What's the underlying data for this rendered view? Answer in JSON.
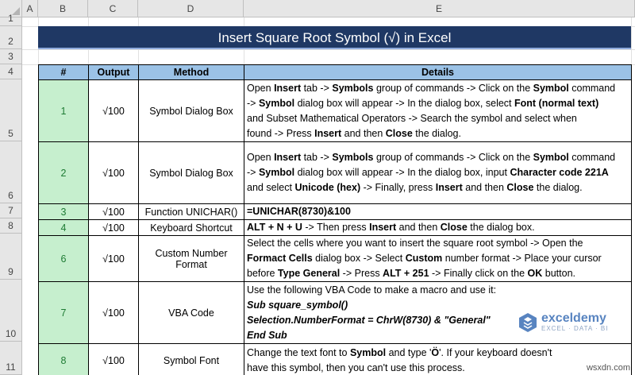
{
  "columns": [
    "A",
    "B",
    "C",
    "D",
    "E"
  ],
  "rows": [
    "1",
    "2",
    "3",
    "4",
    "5",
    "6",
    "7",
    "8",
    "9",
    "10",
    "11"
  ],
  "title": "Insert Square Root Symbol (√) in Excel",
  "headers": {
    "num": "#",
    "output": "Output",
    "method": "Method",
    "details": "Details"
  },
  "entries": [
    {
      "num": "1",
      "output": "√100",
      "method": "Symbol Dialog Box"
    },
    {
      "num": "2",
      "output": "√100",
      "method": "Symbol Dialog Box"
    },
    {
      "num": "3",
      "output": "√100",
      "method": "Function UNICHAR()"
    },
    {
      "num": "4",
      "output": "√100",
      "method": "Keyboard Shortcut"
    },
    {
      "num": "6",
      "output": "√100",
      "method": "Custom Number Format"
    },
    {
      "num": "7",
      "output": "√100",
      "method": "VBA Code"
    },
    {
      "num": "8",
      "output": "√100",
      "method": "Symbol Font"
    }
  ],
  "details": {
    "d1": {
      "t1": "Open ",
      "b1": "Insert",
      "t2": " tab -> ",
      "b2": "Symbols",
      "t3": " group of commands -> Click on the ",
      "b3": "Symbol",
      "t4": " command",
      "t5": "-> ",
      "b4": "Symbol",
      "t6": " dialog box will appear -> In the dialog box, select ",
      "b5": "Font (normal text)",
      "t7": "and Subset Mathematical Operators -> Search the symbol and select when",
      "t8": "found -> Press ",
      "b6": "Insert",
      "t9": " and then ",
      "b7": "Close",
      "t10": " the dialog."
    },
    "d2": {
      "t1": "Open ",
      "b1": "Insert",
      "t2": " tab -> ",
      "b2": "Symbols",
      "t3": " group of commands -> Click on the ",
      "b3": "Symbol",
      "t4": " command",
      "t5": "-> ",
      "b4": "Symbol",
      "t6": " dialog box will appear -> In the dialog box, input ",
      "b5": "Character code 221A",
      "t7": "and select ",
      "b6": "Unicode (hex)",
      "t8": " -> Finally, press ",
      "b7": "Insert",
      "t9": " and then ",
      "b8": "Close",
      "t10": " the dialog."
    },
    "d3": {
      "b1": "=UNICHAR(8730)&100"
    },
    "d4": {
      "b1": "ALT + N + U",
      "t1": " -> Then press ",
      "b2": "Insert",
      "t2": " and then ",
      "b3": "Close",
      "t3": " the dialog box."
    },
    "d6": {
      "t1": "Select the cells where you want to insert the square root symbol -> Open the",
      "b1": "Formact Cells",
      "t2": " dialog box -> Select ",
      "b2": "Custom",
      "t3": " number format -> Place your cursor",
      "t4": "before ",
      "b3": "Type General",
      "t5": " -> Press ",
      "b4": "ALT + 251",
      "t6": " -> Finally click on the ",
      "b5": "OK",
      "t7": " button."
    },
    "d7": {
      "t1": "Use the following VBA Code to make a macro and use it:",
      "i1": "Sub square_symbol()",
      "i2": "Selection.NumberFormat = ChrW(8730) & \"General\"",
      "i3": "End Sub"
    },
    "d8": {
      "t1": "Change the text font to ",
      "b1": "Symbol",
      "t2": " and type '",
      "b2": "Ö",
      "t3": "'. If your keyboard doesn't",
      "t4": "have this symbol, then you can't use this process."
    }
  },
  "watermark": {
    "name": "exceldemy",
    "tagline": "EXCEL · DATA · BI"
  },
  "site": "wsxdn.com",
  "colors": {
    "title_bg": "#1f3864",
    "header_bg": "#9bc2e6",
    "num_bg": "#c6efce",
    "num_text": "#1e7b34"
  }
}
